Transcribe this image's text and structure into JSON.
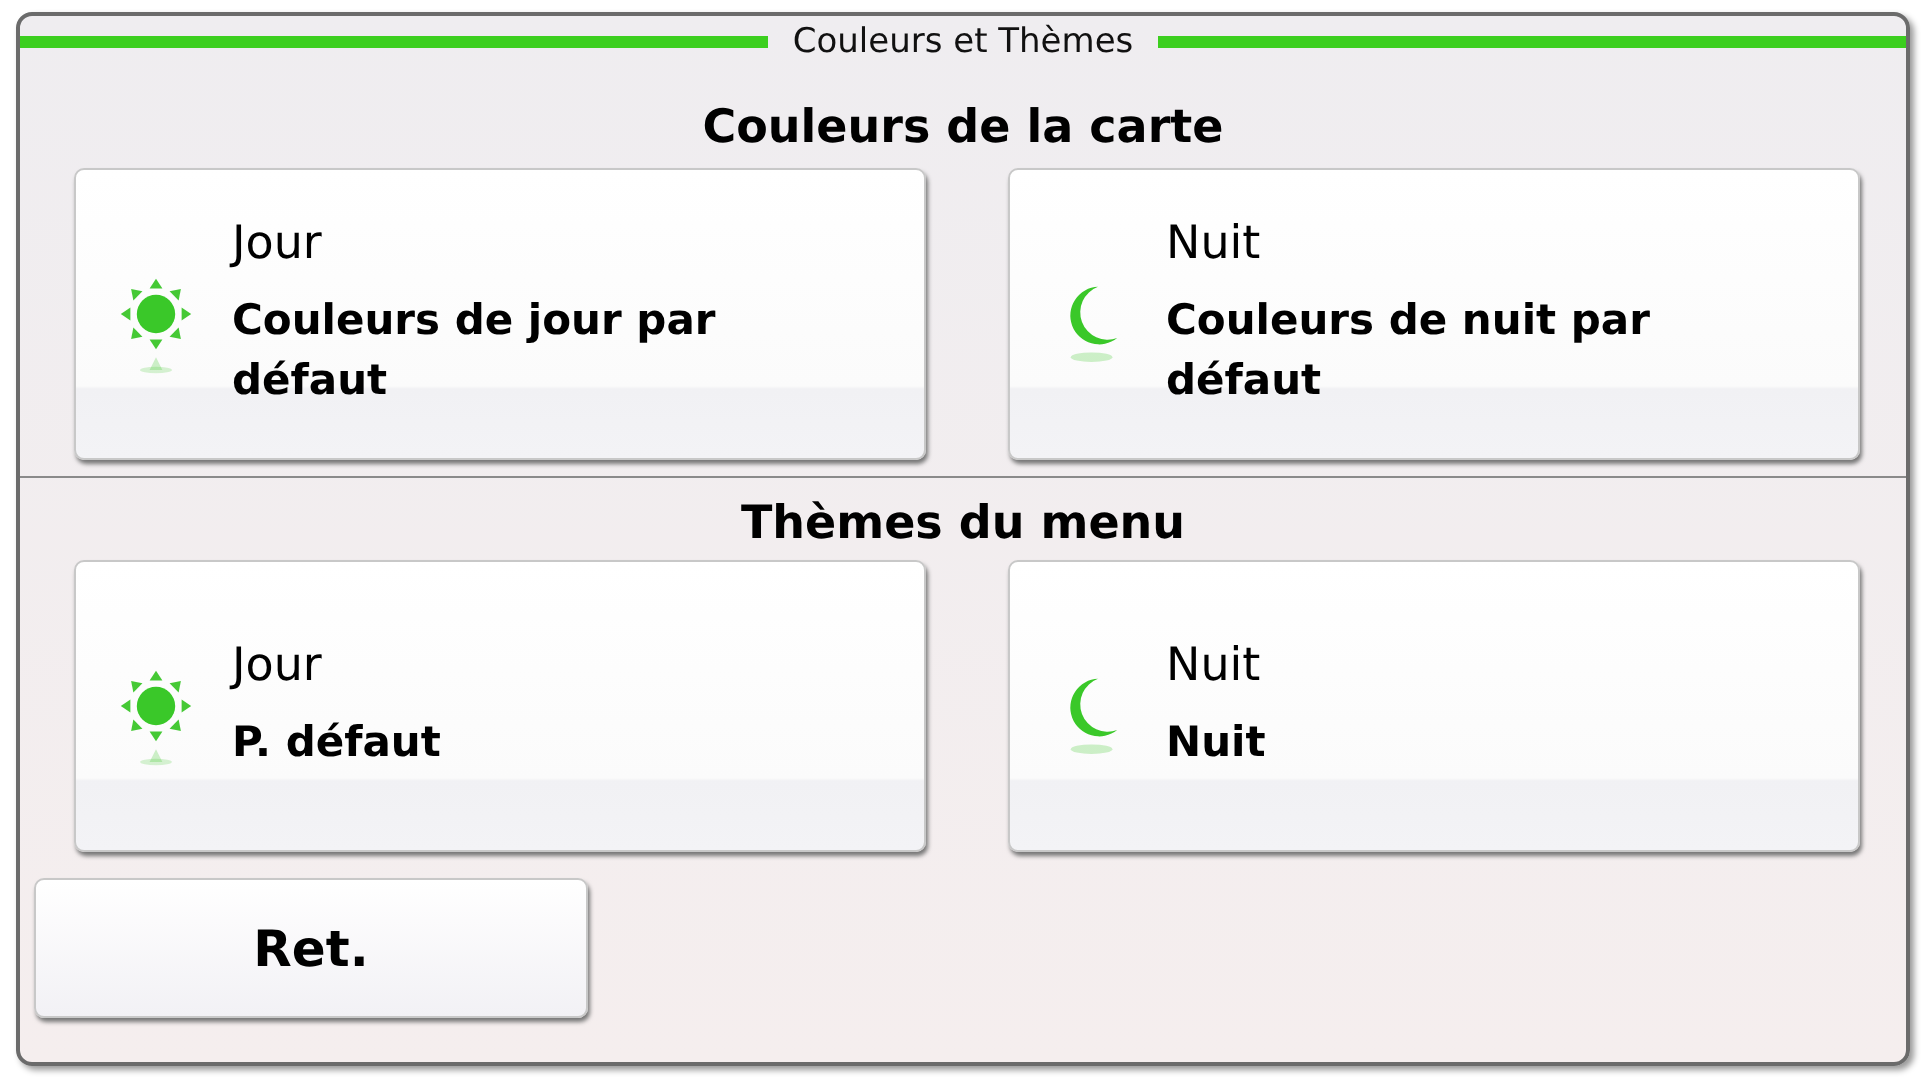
{
  "window": {
    "title": "Couleurs et Thèmes"
  },
  "sections": [
    {
      "heading": "Couleurs de la carte",
      "options": [
        {
          "kind": "day",
          "label": "Jour",
          "value": "Couleurs de jour par défaut"
        },
        {
          "kind": "night",
          "label": "Nuit",
          "value": "Couleurs de nuit par défaut"
        }
      ]
    },
    {
      "heading": "Thèmes du menu",
      "options": [
        {
          "kind": "day",
          "label": "Jour",
          "value": "P. défaut"
        },
        {
          "kind": "night",
          "label": "Nuit",
          "value": "Nuit"
        }
      ]
    }
  ],
  "back_button": "Ret."
}
